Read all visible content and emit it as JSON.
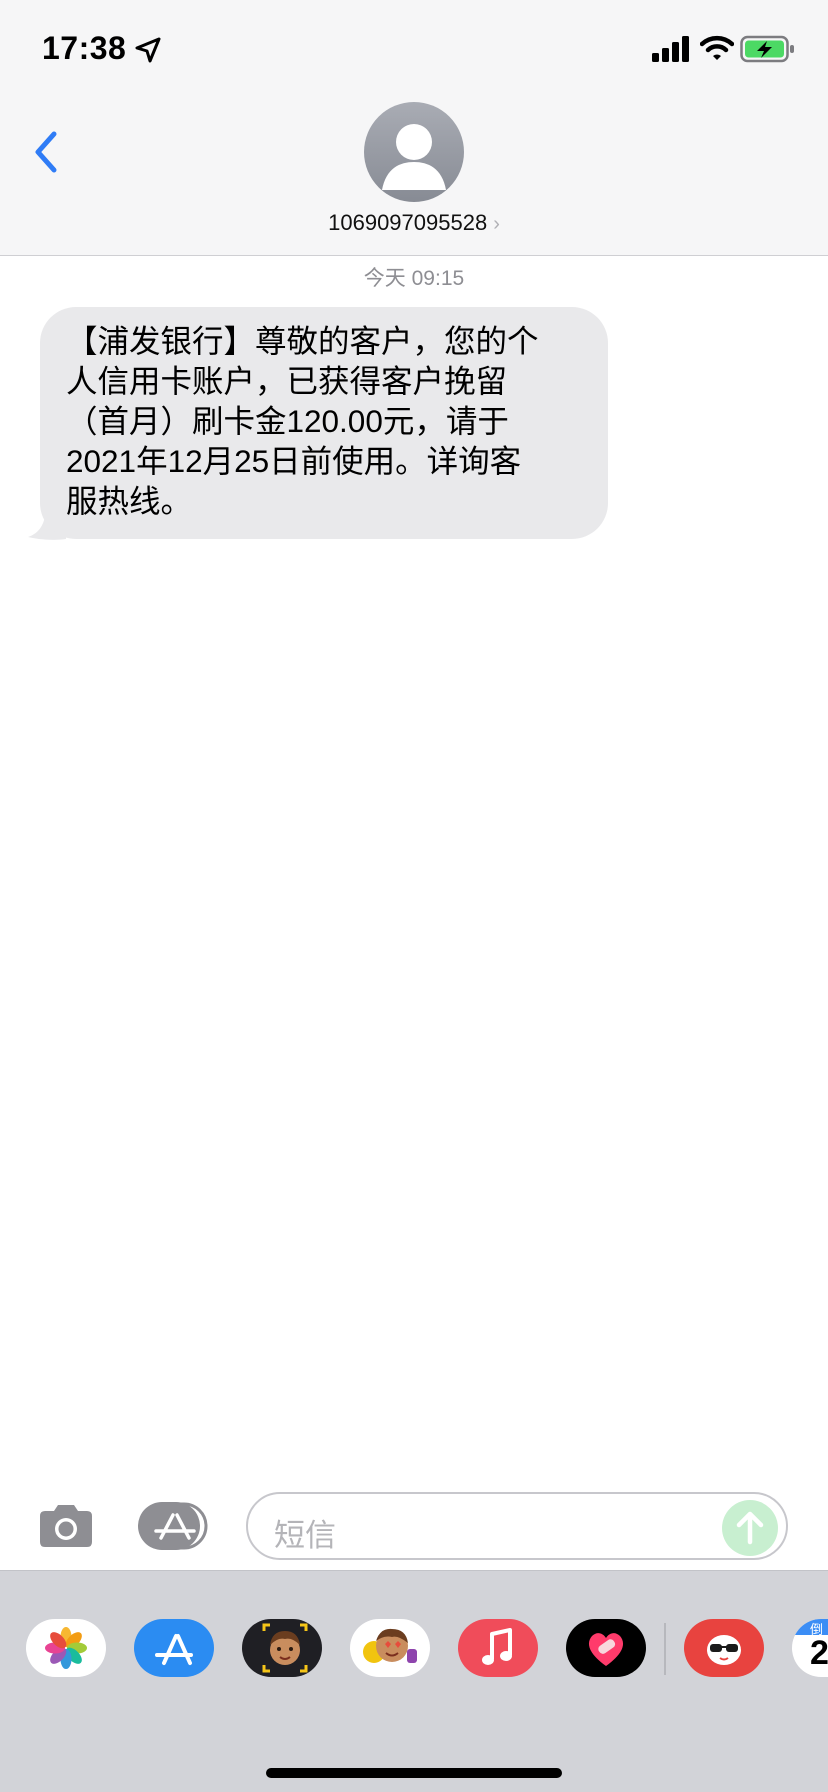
{
  "status_bar": {
    "time": "17:38",
    "icons": [
      "location-arrow-icon",
      "cellular-signal-icon",
      "wifi-icon",
      "battery-charging-icon"
    ]
  },
  "header": {
    "back_icon": "chevron-left-icon",
    "contact_number": "1069097095528",
    "detail_chevron": "›"
  },
  "conversation": {
    "timestamp": "今天 09:15",
    "messages": [
      {
        "direction": "incoming",
        "lines": [
          "【浦发银行】尊敬的客户，您的个",
          "人信用卡账户，已获得客户挽留",
          "（首月）刷卡金120.00元，请于",
          "2021年12月25日前使用。详询客",
          "服热线。"
        ]
      }
    ]
  },
  "composer": {
    "placeholder": "短信",
    "camera_icon": "camera-icon",
    "apps_icon": "app-store-icon"
  },
  "app_drawer": {
    "apps": [
      "photos-app",
      "app-store-app",
      "memoji-app",
      "animoji-app",
      "music-app",
      "heart-sticker-app",
      "sunglasses-sticker-app",
      "calendar-app"
    ],
    "calendar_partial": [
      "倒",
      "2"
    ]
  },
  "colors": {
    "accent_blue": "#2f7cf6",
    "bubble_gray": "#e9e9eb",
    "send_green": "#c8efd0"
  }
}
